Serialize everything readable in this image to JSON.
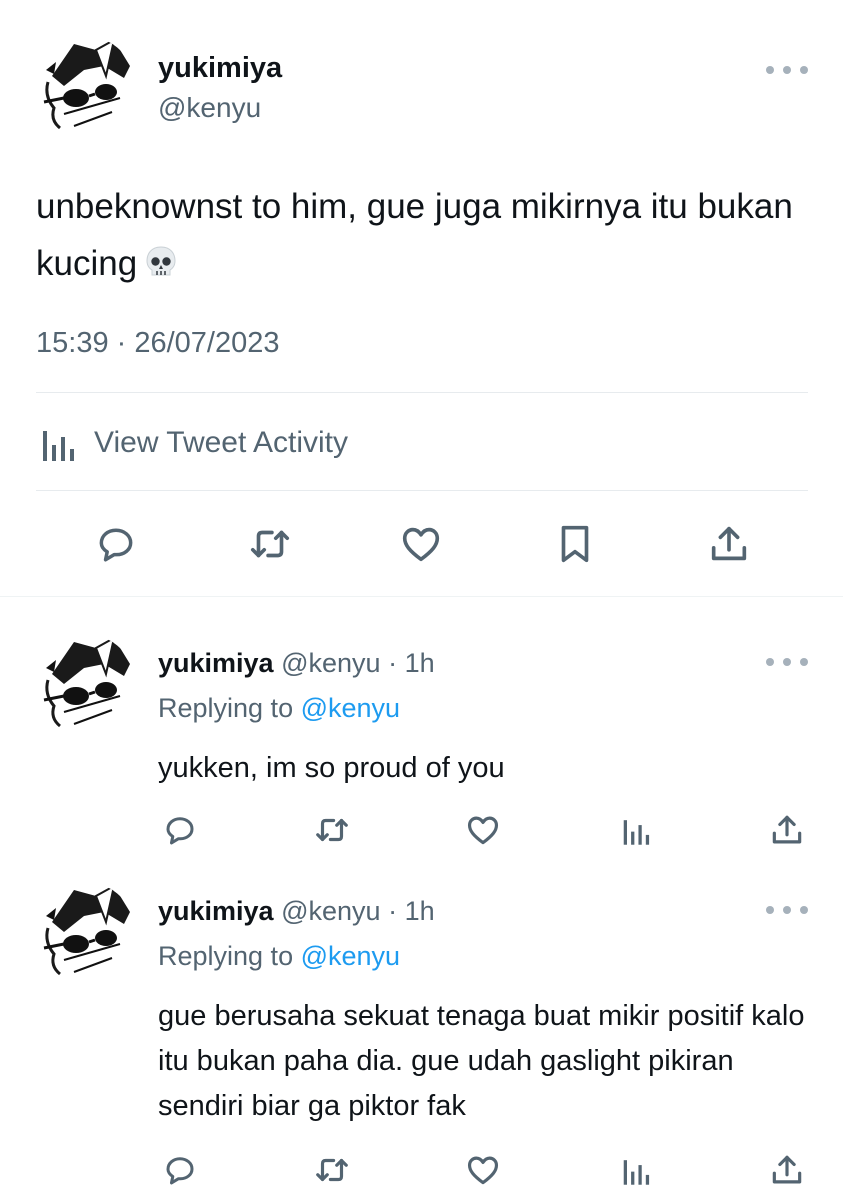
{
  "tweet": {
    "display_name": "yukimiya",
    "handle": "@kenyu",
    "text": "unbeknownst to him, gue juga mikirnya itu bukan kucing",
    "emoji": "skull",
    "timestamp": "15:39 · 26/07/2023",
    "activity_label": "View Tweet Activity",
    "actions": [
      "reply-icon",
      "retweet-icon",
      "like-icon",
      "bookmark-icon",
      "share-icon"
    ]
  },
  "replies": [
    {
      "display_name": "yukimiya",
      "handle": "@kenyu",
      "time": "· 1h",
      "replying_prefix": "Replying to",
      "replying_to": "@kenyu",
      "text": "yukken, im so proud of you"
    },
    {
      "display_name": "yukimiya",
      "handle": "@kenyu",
      "time": "· 1h",
      "replying_prefix": "Replying to",
      "replying_to": "@kenyu",
      "text": "gue berusaha sekuat tenaga buat mikir positif kalo itu bukan paha dia. gue udah gaslight pikiran sendiri biar ga piktor fak"
    }
  ],
  "colors": {
    "text": "#0f1419",
    "secondary": "#536471",
    "mention": "#1d9bf0",
    "divider": "#e7ebee"
  }
}
